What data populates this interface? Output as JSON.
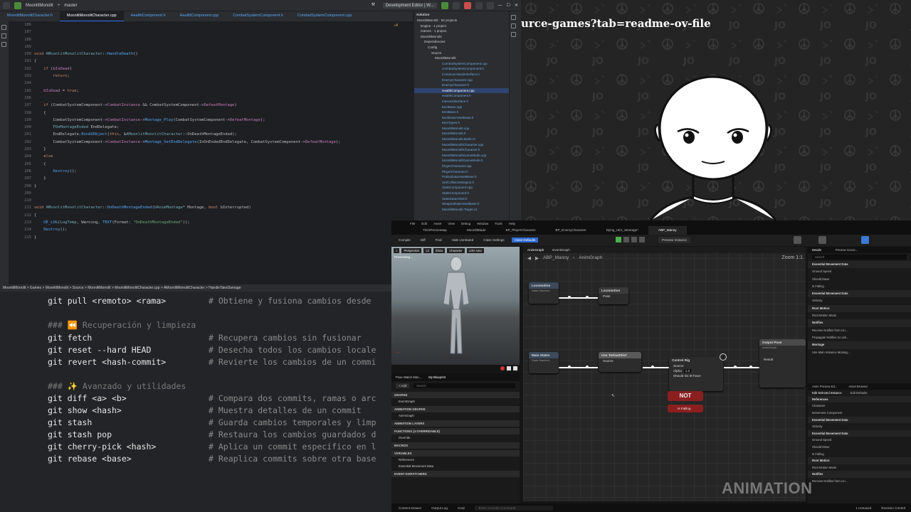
{
  "ide": {
    "project": "MoonlitMonolit",
    "branch": "master",
    "run_config": "Development Editor | W...",
    "tabs": [
      "MoonlitMonolitCharacter.h",
      "MoonlitMonolitCharacter.cpp",
      "HealthComponent.h",
      "HealthComponent.cpp",
      "CombatSystemComponent.h",
      "CombatSystemComponent.cpp"
    ],
    "active_tab": 1,
    "problems": "⚠4",
    "line_numbers": [
      "186",
      "187",
      "188",
      "189",
      "190",
      "191",
      "192",
      "193",
      "194",
      "195",
      "196",
      "197",
      "198",
      "199",
      "200",
      "201",
      "202",
      "203",
      "204",
      "205",
      "206",
      "207",
      "208",
      "209",
      "210",
      "211",
      "212",
      "213",
      "214",
      "215"
    ],
    "code": [
      "",
      "",
      "",
      "",
      "void AMoonlitMonolitCharacter::HandleDeath()",
      "{",
      "    if (bIsDead)",
      "        return;",
      "",
      "    bIsDead = true;",
      "",
      "    if (CombatSystemComponent->CombatInstance && CombatSystemComponent->DefeatMontage)",
      "    {",
      "        CombatSystemComponent->CombatInstance->Montage_Play(CombatSystemComponent->DefeatMontage);",
      "        FOnMontageEnded EndDelegate;",
      "        EndDelegate.BindUObject(this, &AMoonlitMonolitCharacter::OnDeathMontageEnded);",
      "        CombatSystemComponent->CombatInstance->Montage_SetEndDelegate(InOnEndedEndDelegate, CombatSystemComponent->DefeatMontage);",
      "    }",
      "    else",
      "    {",
      "        Destroy();",
      "    }",
      "}",
      "",
      "",
      "void AMoonlitMonolitCharacter::OnDeathMontageEnded(UAnimMontage* Montage, bool bInterrupted)",
      "{",
      "    UE_LOG(LogTemp, Warning, TEXT(Format: \"OnDeathMontageEnded\"));",
      "    Destroy();",
      "}"
    ],
    "solution": {
      "header": "Solution",
      "rows": [
        "MoonlitMonolit · 52 projects",
        "Engine · 1 project",
        "Games · 1 project",
        "MoonlitMonolit",
        "Dependencies",
        "Config",
        "Source",
        "MoonlitMonolit",
        "CombatSystemComponent.cpp",
        "CombatSystemComponent.h",
        "ContinueAttackInterface.h",
        "EnemyCharacter.cpp",
        "EnemyCharacter.h",
        "HealthComponent.cpp",
        "HealthComponent.h",
        "InteractInterface.h",
        "ItemBase.cpp",
        "ItemBase.h",
        "ItemDataAssetBase.h",
        "ItemTypes.h",
        "MoonlitMonolit.cpp",
        "MoonlitMonolit.h",
        "MoonlitMonolit.Build.cs",
        "MoonlitMonolitCharacter.cpp",
        "MoonlitMonolitCharacter.h",
        "MoonlitMonolitGameMode.cpp",
        "MoonlitMonolitGameMode.h",
        "PlayerCharacter.cpp",
        "PlayerCharacter.h",
        "PotionDataAssetBase.h",
        "SetCollisionWeapon.h",
        "StatsComponent.cpp",
        "StatsComponent.h",
        "StatsDataAsset.h",
        "WeaponDataAssetBase.h",
        "MoonlitMonolit.Target.cs"
      ],
      "selected": 13
    },
    "statusbar": "MoonlitMonolit  >  Games  >  MoonlitMonolit  >  Source  >  MoonlitMonolit  >  MoonlitMonolitCharacter.cpp  >  AMoonlitMonolitCharacter  >  HandleTakeDamage"
  },
  "terminal": {
    "lines": [
      {
        "cmd": "git pull <remoto> <rama>",
        "cmt": "# Obtiene y fusiona cambios desde"
      },
      {
        "hdr": "### ⏪ Recuperación y limpieza"
      },
      {
        "cmd": "git fetch",
        "cmt": "# Recupera cambios sin fusionar"
      },
      {
        "cmd": "git reset --hard HEAD",
        "cmt": "# Desecha todos los cambios locale"
      },
      {
        "cmd": "git revert <hash-commit>",
        "cmt": "# Revierte los cambios de un commi"
      },
      {
        "hdr": "### ✨ Avanzado y utilidades"
      },
      {
        "cmd": "git diff <a> <b>",
        "cmt": "# Compara dos commits, ramas o arc"
      },
      {
        "cmd": "git show <hash>",
        "cmt": "# Muestra detalles de un commit"
      },
      {
        "cmd": "git stash",
        "cmt": "# Guarda cambios temporales y limp"
      },
      {
        "cmd": "git stash pop",
        "cmt": "# Restaura los cambios guardados d"
      },
      {
        "cmd": "git cherry-pick <hash>",
        "cmt": "# Aplica un commit específico en l"
      },
      {
        "cmd": "git rebase <base>",
        "cmt": "# Reaplica commits sobre otra base"
      }
    ]
  },
  "overlay": {
    "url_text": "urce-games?tab=readme-ov-file"
  },
  "unreal": {
    "menu": [
      "File",
      "Edit",
      "Asset",
      "View",
      "Debug",
      "Window",
      "Tools",
      "Help"
    ],
    "parent_class": "Parent class: AnimInstance",
    "tabs": [
      "ThirdPersonMap",
      "MoonlitBlade",
      "BP_PlayerCharacter",
      "BP_EnemyCharacter",
      "Dying_UE1_Montage*",
      "ABP_Manny"
    ],
    "active_tab": 5,
    "toolbar": [
      "Compile",
      "Diff",
      "Find",
      "Hide Unrelated",
      "Class Settings",
      "Class Defaults"
    ],
    "preview": "Preview Instance",
    "viewport": {
      "perspective": "Perspective",
      "lit": "Lit",
      "show": "Show",
      "character": "Character",
      "lod": "LOD Auto",
      "preview_text": "Previewing..."
    },
    "graph": {
      "breadcrumb": [
        "ABP_Manny",
        "AnimGraph"
      ],
      "tab1": "AnimGraph",
      "tab2": "EventGraph",
      "zoom": "Zoom 1:1",
      "nodes": {
        "locomotion_sm": "Locomotion",
        "locomotion_sm_sub": "State Machine",
        "locomotion_cache": "Locomotion",
        "pose": "Pose",
        "main_states": "Main States",
        "main_states_sub": "State Machine",
        "use_cached": "Use 'DefaultSlot'",
        "source": "Source",
        "control_rig": "Control Rig",
        "control_source": "Source",
        "alpha": "Alpha",
        "alpha_val": "1.0",
        "should_ik": "Should Do IKTrace",
        "not": "NOT",
        "is_falling": "Is Falling",
        "output_pose": "Output Pose",
        "output_sub": "AnimGraph",
        "result": "Result"
      }
    },
    "bp_panel": {
      "tabs": [
        "Pose Watch Man...",
        "My Blueprint"
      ],
      "add": "+ Add",
      "search": "Search",
      "sections": [
        "GRAPHS",
        "EventGraph",
        "ANIMATION GRAPHS",
        "AnimGraph",
        "ANIMATION LAYERS",
        "FUNCTIONS (4 OVERRIDABLE)",
        "Override",
        "MACROS",
        "VARIABLES",
        "References",
        "Essential Movement Data",
        "EVENT DISPATCHERS"
      ]
    },
    "details": {
      "tabs": [
        "Details",
        "Preview Scene..."
      ],
      "search": "Search",
      "rows": [
        "Essential Movement Data",
        "Ground Speed",
        "Should Move",
        "Is Falling",
        "Essential Movement Data",
        "Velocity",
        "Root Motion",
        "Root Motion Mode",
        "Notifies",
        "Receive Notifies from Lin...",
        "Propagate Notifies to Link...",
        "Montage",
        "Use Main Instance Montag..."
      ],
      "ground_speed": "0.0",
      "velocity": [
        "0.0",
        "0.0",
        "0.0"
      ],
      "root_motion": "Root Motion from Montages",
      "preview_tabs": [
        "Anim Preview Ed...",
        "Asset Browser"
      ],
      "preview_sub": [
        "Edit Selected Instance",
        "Edit Defaults"
      ],
      "preview_rows": [
        "References",
        "Character",
        "Movement Component",
        "Essential Movement Data",
        "Velocity",
        "Essential Movement Data",
        "Ground Speed",
        "Should Move",
        "Is Falling",
        "Root Motion",
        "Root Motion Mode",
        "Notifies",
        "Receive Notifies from Lin..."
      ],
      "none": "None"
    },
    "bottom": [
      "Content Drawer",
      "Output Log",
      "Cmd"
    ],
    "console_placeholder": "Enter Console Command",
    "unsaved": "1 Unsaved",
    "revision": "Revision Control"
  },
  "watermark": "ANIMATION"
}
